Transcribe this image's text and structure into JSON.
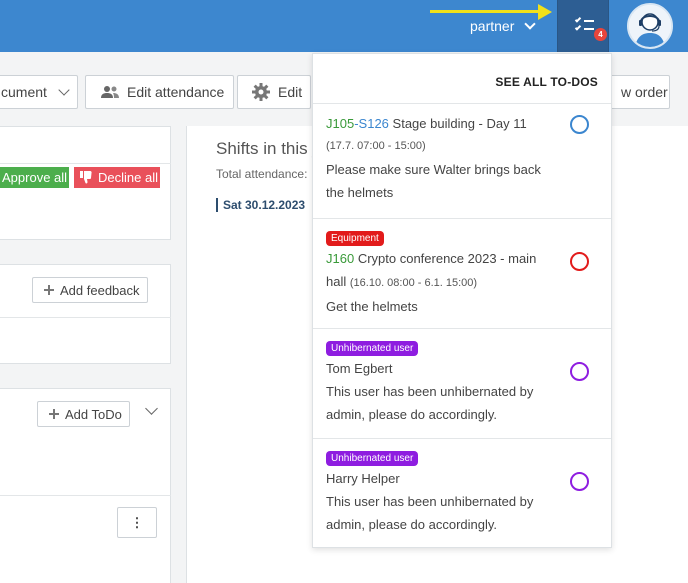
{
  "header": {
    "user_menu": "partner",
    "todo_count": "4",
    "colors": {
      "bar": "#3d87cf",
      "todo_button": "#2d5e93",
      "badge": "#e8453c",
      "arrow": "#f1e11a"
    }
  },
  "toolbar": {
    "document_label": "cument",
    "edit_attendance_label": "Edit attendance",
    "edit_label": "Edit",
    "order_label": "w order"
  },
  "left": {
    "approve_all": "Approve all",
    "decline_all": "Decline all",
    "add_feedback": "Add feedback",
    "add_todo": "Add ToDo",
    "more_menu": "⋮"
  },
  "main": {
    "shifts_title": "Shifts in this j",
    "total_attendance": "Total attendance:",
    "date": "Sat 30.12.2023"
  },
  "todos": {
    "see_all": "SEE ALL TO-DOS",
    "items": [
      {
        "tag": "",
        "job": "J105",
        "sep": "-",
        "shift": "S126",
        "title": " Stage building - Day 11",
        "time": "(17.7. 07:00 - 15:00)",
        "description": "Please make sure Walter brings back the helmets",
        "circle_color": "#3b86cf"
      },
      {
        "tag": "Equipment",
        "tag_color": "#e21b1b",
        "job": "J160",
        "title": " Crypto conference 2023 - main hall",
        "time": "(16.10. 08:00 - 6.1. 15:00)",
        "description": "Get the helmets",
        "circle_color": "#e21b1b"
      },
      {
        "tag": "Unhibernated user",
        "tag_color": "#8e1de0",
        "title": "Tom Egbert",
        "description": "This user has been unhibernated by admin, please do accordingly.",
        "circle_color": "#8e1de0"
      },
      {
        "tag": "Unhibernated user",
        "tag_color": "#8e1de0",
        "title": "Harry Helper",
        "description": "This user has been unhibernated by admin, please do accordingly.",
        "circle_color": "#8e1de0"
      }
    ]
  }
}
